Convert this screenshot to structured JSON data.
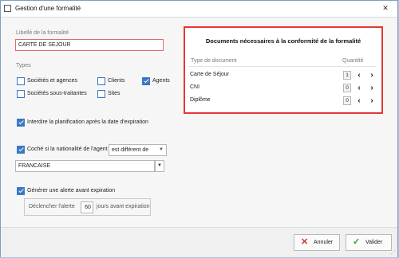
{
  "window": {
    "title": "Gestion d'une formalité",
    "close_glyph": "✕"
  },
  "libelle": {
    "label": "Libellé de la formalité",
    "value": "CARTE DE SEJOUR"
  },
  "types": {
    "label": "Types",
    "items": [
      {
        "label": "Sociétés et agences",
        "checked": false
      },
      {
        "label": "Clients",
        "checked": false
      },
      {
        "label": "Agents",
        "checked": true
      },
      {
        "label": "Sociétés sous-traitantes",
        "checked": false
      },
      {
        "label": "Sites",
        "checked": false
      }
    ]
  },
  "interdire": {
    "label": "Interdire la planification après la date d'expiration",
    "checked": true
  },
  "nationalite": {
    "label": "Coché si la nationalité de l'agent",
    "checked": true,
    "operator": "est différent de",
    "value": "FRANCAISE"
  },
  "alerte": {
    "label": "Générer une alerte avant expiration",
    "checked": true,
    "prefix": "Déclencher l'alerte",
    "days": "60",
    "suffix": "jours avant expiration"
  },
  "documents": {
    "title": "Documents nécessaires à la conformité de la formalité",
    "col_type": "Type de document",
    "col_qty": "Quantité",
    "rows": [
      {
        "name": "Carte de Séjour",
        "qty": "1"
      },
      {
        "name": "CNI",
        "qty": "0"
      },
      {
        "name": "Diplôme",
        "qty": "0"
      }
    ]
  },
  "footer": {
    "cancel_label": "Annuler",
    "validate_label": "Valider"
  },
  "colors": {
    "accent": "#3a78c4",
    "highlight_border": "#e53935",
    "cancel_icon": "#d32f2f",
    "validate_icon": "#2e9e3e"
  }
}
